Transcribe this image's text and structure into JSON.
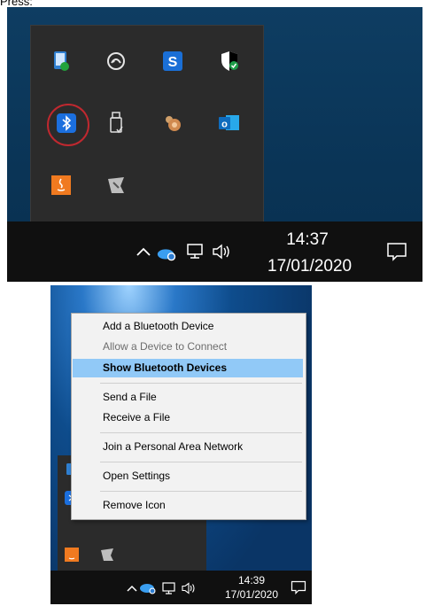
{
  "caption": "Press:",
  "top": {
    "tray_icons": [
      {
        "name": "phone-sync-icon",
        "color": "#2f7fd0"
      },
      {
        "name": "gamepad-icon",
        "color": "#dddddd"
      },
      {
        "name": "sophos-icon",
        "color": "#1a6fd6"
      },
      {
        "name": "security-shield-icon",
        "color": "#1e9e49"
      },
      {
        "name": "bluetooth-icon",
        "color": "#1b6fde"
      },
      {
        "name": "usb-drive-icon",
        "color": "#e0e0e0"
      },
      {
        "name": "gesture-hand-icon",
        "color": "#d08a4f"
      },
      {
        "name": "outlook-icon",
        "color": "#0f6cbd"
      },
      {
        "name": "java-icon",
        "color": "#f07a20"
      },
      {
        "name": "snip-tool-icon",
        "color": "#bdbdbd"
      }
    ],
    "clock": {
      "time": "14:37",
      "date": "17/01/2020"
    }
  },
  "bottom": {
    "clock": {
      "time": "14:39",
      "date": "17/01/2020"
    },
    "menu": [
      {
        "label": "Add a Bluetooth Device",
        "state": "normal"
      },
      {
        "label": "Allow a Device to Connect",
        "state": "disabled"
      },
      {
        "label": "Show Bluetooth Devices",
        "state": "highlighted"
      },
      {
        "label": "Send a File",
        "state": "normal"
      },
      {
        "label": "Receive a File",
        "state": "normal"
      },
      {
        "label": "Join a Personal Area Network",
        "state": "normal"
      },
      {
        "label": "Open Settings",
        "state": "normal"
      },
      {
        "label": "Remove Icon",
        "state": "normal"
      }
    ]
  }
}
